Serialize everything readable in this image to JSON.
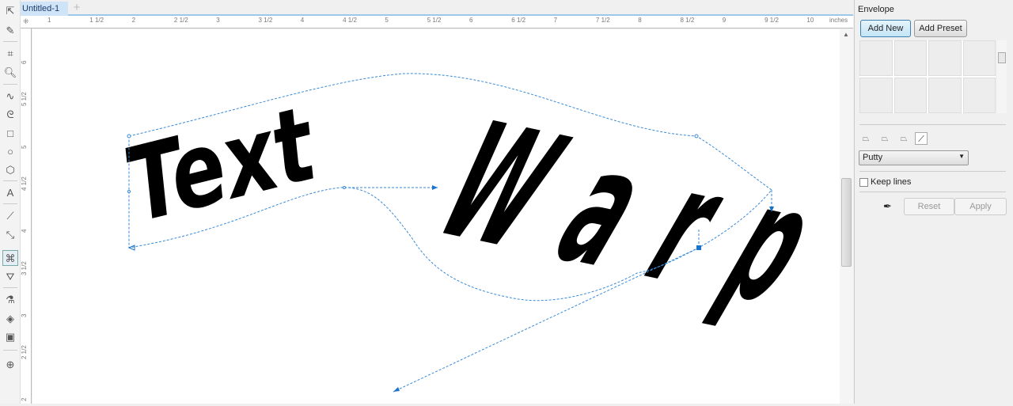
{
  "document_tab": {
    "title": "Untitled-1",
    "add": "+"
  },
  "ruler": {
    "units": "inches",
    "h_labels": [
      "1",
      "1 1/2",
      "2",
      "2 1/2",
      "3",
      "3 1/2",
      "4",
      "4 1/2",
      "5",
      "5 1/2",
      "6",
      "6 1/2",
      "7",
      "7 1/2",
      "8",
      "8 1/2",
      "9",
      "9 1/2",
      "10"
    ],
    "v_labels": [
      "6",
      "5 1/2",
      "5",
      "4 1/2",
      "4",
      "3 1/2",
      "3",
      "2 1/2",
      "2"
    ]
  },
  "canvas": {
    "text_line1": "Text",
    "text_line2": "Warp"
  },
  "envelope_panel": {
    "title": "Envelope",
    "add_new": "Add New",
    "add_preset": "Add Preset",
    "mapping_mode": "Putty",
    "keep_lines_label": "Keep lines",
    "keep_lines_checked": false,
    "reset": "Reset",
    "apply": "Apply"
  },
  "colors": {
    "accent": "#1a73c9",
    "envelope_line": "#3a8ad6"
  }
}
